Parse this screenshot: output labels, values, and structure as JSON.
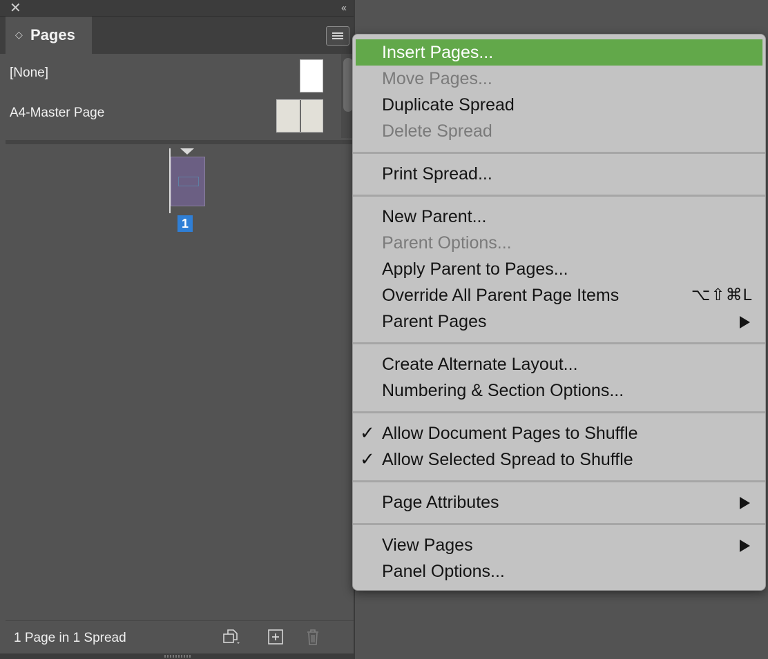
{
  "panel": {
    "title": "Pages",
    "parents": [
      {
        "label": "[None]"
      },
      {
        "label": "A4-Master Page"
      }
    ],
    "page_number": "1",
    "footer_status": "1 Page in 1 Spread"
  },
  "menu": {
    "items": [
      {
        "label": "Insert Pages...",
        "state": "highlighted"
      },
      {
        "label": "Move Pages...",
        "state": "disabled"
      },
      {
        "label": "Duplicate Spread",
        "state": "enabled"
      },
      {
        "label": "Delete Spread",
        "state": "disabled"
      },
      {
        "label": "Print Spread...",
        "state": "enabled"
      },
      {
        "label": "New Parent...",
        "state": "enabled"
      },
      {
        "label": "Parent Options...",
        "state": "disabled"
      },
      {
        "label": "Apply Parent to Pages...",
        "state": "enabled"
      },
      {
        "label": "Override All Parent Page Items",
        "state": "enabled",
        "shortcut": "⌥⇧⌘L"
      },
      {
        "label": "Parent Pages",
        "state": "enabled",
        "submenu": true
      },
      {
        "label": "Create Alternate Layout...",
        "state": "enabled"
      },
      {
        "label": "Numbering & Section Options...",
        "state": "enabled"
      },
      {
        "label": "Allow Document Pages to Shuffle",
        "state": "enabled",
        "checked": true
      },
      {
        "label": "Allow Selected Spread to Shuffle",
        "state": "enabled",
        "checked": true
      },
      {
        "label": "Page Attributes",
        "state": "enabled",
        "submenu": true
      },
      {
        "label": "View Pages",
        "state": "enabled",
        "submenu": true
      },
      {
        "label": "Panel Options...",
        "state": "enabled"
      }
    ],
    "check_glyph": "✓"
  },
  "colors": {
    "highlight": "#62a84a",
    "selected_page": "#2f7fd6",
    "panel_bg": "#535353",
    "menu_bg": "#c3c3c3"
  },
  "icons": [
    "close-icon",
    "collapse-panel-icon",
    "panel-menu-icon",
    "edit-page-size-icon",
    "new-page-icon",
    "delete-page-icon"
  ]
}
